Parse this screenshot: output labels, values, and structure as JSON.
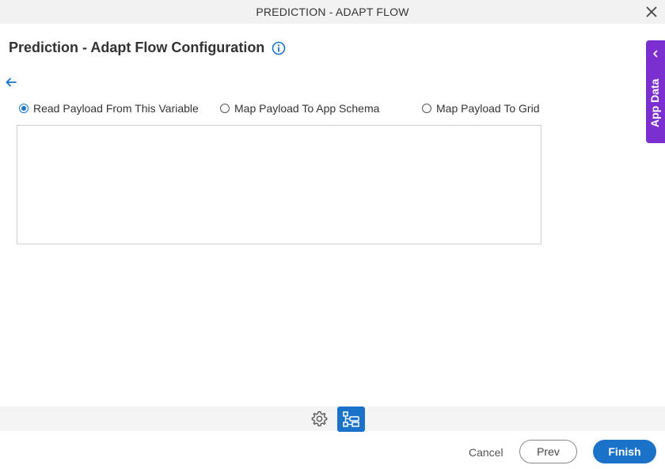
{
  "window": {
    "title": "PREDICTION - ADAPT FLOW",
    "close_icon": "close-icon"
  },
  "header": {
    "title": "Prediction - Adapt Flow Configuration",
    "info_icon": "info-icon"
  },
  "navigation": {
    "back_icon": "back-arrow-icon"
  },
  "payload_options": [
    {
      "label": "Read Payload From This Variable",
      "selected": true
    },
    {
      "label": "Map Payload To App Schema",
      "selected": false
    },
    {
      "label": "Map Payload To Grid",
      "selected": false
    }
  ],
  "payload_box": {
    "value": ""
  },
  "side_panel": {
    "label": "App Data",
    "color": "#7b2fd0"
  },
  "toolbar": {
    "items": [
      "gear-icon",
      "flow-icon"
    ],
    "active_item": "flow-icon",
    "active_color": "#1a73c9"
  },
  "footer": {
    "cancel_label": "Cancel",
    "prev_label": "Prev",
    "finish_label": "Finish"
  }
}
